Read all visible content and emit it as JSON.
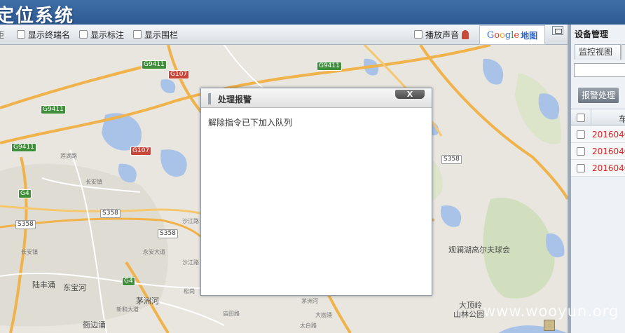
{
  "window": {
    "title": "定位系统"
  },
  "toolbar": {
    "cut_label": "距",
    "show_terminal_name": "显示终端名",
    "show_marker": "显示标注",
    "show_fence": "显示围栏",
    "play_sound": "播放声音",
    "map_word": "地图"
  },
  "map": {
    "roads": [
      "G9411",
      "G9411",
      "G9411",
      "G9411",
      "G107",
      "G107",
      "G4",
      "G4",
      "S358",
      "S358",
      "S358",
      "S358"
    ],
    "places": [
      "陆丰涌",
      "东宝河",
      "茅洲河",
      "衙边涌",
      "观澜湖高尔夫球会",
      "大顶岭",
      "山林公园"
    ],
    "small_places": [
      "莲湖路",
      "长安镇",
      "沙江路",
      "永安大道",
      "新和大道",
      "松岗",
      "庙田路",
      "茅洲河",
      "大凼涌",
      "太白路",
      "沙江路",
      "长安镇"
    ]
  },
  "dialog": {
    "title": "处理报警",
    "close": "X",
    "message": "解除指令已下加入队列"
  },
  "panel": {
    "title": "设备管理",
    "tab": "监控视图",
    "alarm_button": "报警处理",
    "column": "车",
    "rows": [
      "2016040",
      "2016040",
      "2016040"
    ]
  },
  "watermark": "www.wooyun.org",
  "colors": {
    "header": "#2e5a92",
    "map_bg": "#e8e6df",
    "water": "#a9c3e8",
    "road": "#f0b24a",
    "alert_text": "#e02020"
  }
}
